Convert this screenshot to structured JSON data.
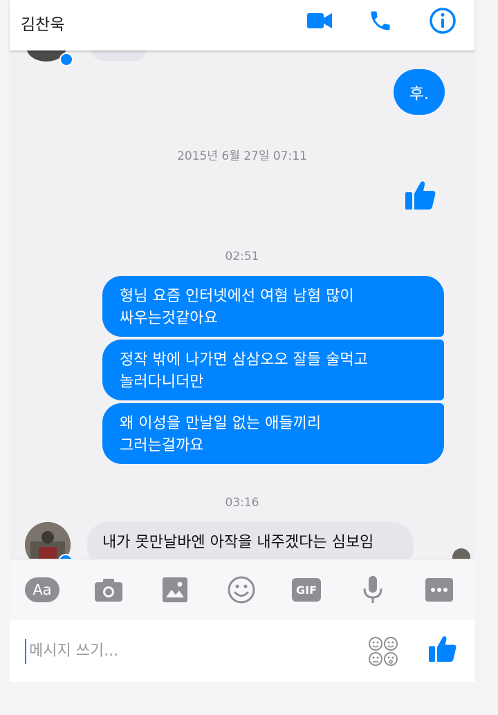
{
  "header": {
    "title": "김찬욱",
    "icons": [
      "video-call-icon",
      "phone-call-icon",
      "info-icon"
    ]
  },
  "messages": {
    "top_outgoing": "후.",
    "timestamp_1": "2015년 6월 27일 07:11",
    "timestamp_2": "02:51",
    "outgoing_1": "형님 요즘 인터넷에선 여혐 남혐 많이\n싸우는것같아요",
    "outgoing_2": "정작 밖에 나가면 삼삼오오 잘들 술먹고\n놀러다니더만",
    "outgoing_3": "왜 이성을 만날일 없는 애들끼리\n그러는걸까요",
    "timestamp_3": "03:16",
    "incoming_1": "내가 못만날바엔 아작을 내주겠다는 심보임"
  },
  "toolbar": {
    "text_button_label": "Aa",
    "gif_label": "GIF"
  },
  "composer": {
    "placeholder": "메시지 쓰기..."
  },
  "colors": {
    "accent": "#0084ff",
    "icon_gray": "#8d8f92",
    "incoming_bubble": "#e4e6eb"
  }
}
